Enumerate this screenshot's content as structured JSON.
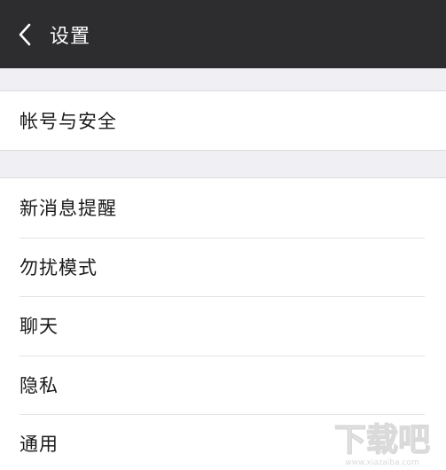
{
  "header": {
    "back_icon": "chevron-left-icon",
    "title": "设置"
  },
  "groups": [
    {
      "items": [
        {
          "label": "帐号与安全"
        }
      ]
    },
    {
      "items": [
        {
          "label": "新消息提醒"
        },
        {
          "label": "勿扰模式"
        },
        {
          "label": "聊天"
        },
        {
          "label": "隐私"
        },
        {
          "label": "通用"
        }
      ]
    }
  ],
  "watermark": {
    "brand": "下载吧",
    "url": "www.xiazaiba.com"
  },
  "colors": {
    "header_bg": "#2d2d30",
    "background": "#efeff4",
    "row_bg": "#ffffff"
  }
}
